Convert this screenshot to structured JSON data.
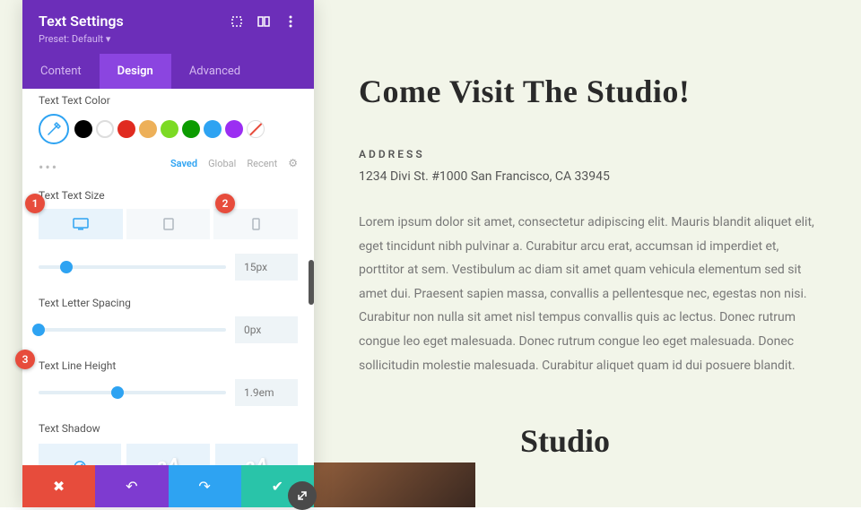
{
  "panel": {
    "title": "Text Settings",
    "preset": "Preset: Default ▾",
    "tabs": {
      "content": "Content",
      "design": "Design",
      "advanced": "Advanced"
    },
    "text_color_label": "Text Text Color",
    "swatches": [
      "#000000",
      "#ffffff",
      "#e02b20",
      "#edb059",
      "#7cda24",
      "#0c9b00",
      "#2ea3f2",
      "#9b2ef2"
    ],
    "saved_row": {
      "saved": "Saved",
      "global": "Global",
      "recent": "Recent"
    },
    "text_size_label": "Text Text Size",
    "text_size_value": "15px",
    "letter_spacing_label": "Text Letter Spacing",
    "letter_spacing_value": "0px",
    "line_height_label": "Text Line Height",
    "line_height_value": "1.9em",
    "text_shadow_label": "Text Shadow",
    "shadow_aa": "aA"
  },
  "callouts": {
    "one": "1",
    "two": "2",
    "three": "3"
  },
  "page": {
    "heading": "Come Visit The Studio!",
    "address_label": "ADDRESS",
    "address": "1234 Divi St. #1000 San Francisco, CA 33945",
    "body": "Lorem ipsum dolor sit amet, consectetur adipiscing elit. Mauris blandit aliquet elit, eget tincidunt nibh pulvinar a. Curabitur arcu erat, accumsan id imperdiet et, porttitor at sem. Vestibulum ac diam sit amet quam vehicula elementum sed sit amet dui. Praesent sapien massa, convallis a pellentesque nec, egestas non nisi. Curabitur non nulla sit amet nisl tempus convallis quis ac lectus. Donec rutrum congue leo eget malesuada. Donec rutrum congue leo eget malesuada. Donec sollicitudin molestie malesuada. Curabitur aliquet quam id dui posuere blandit.",
    "studio_heading": "Studio"
  }
}
